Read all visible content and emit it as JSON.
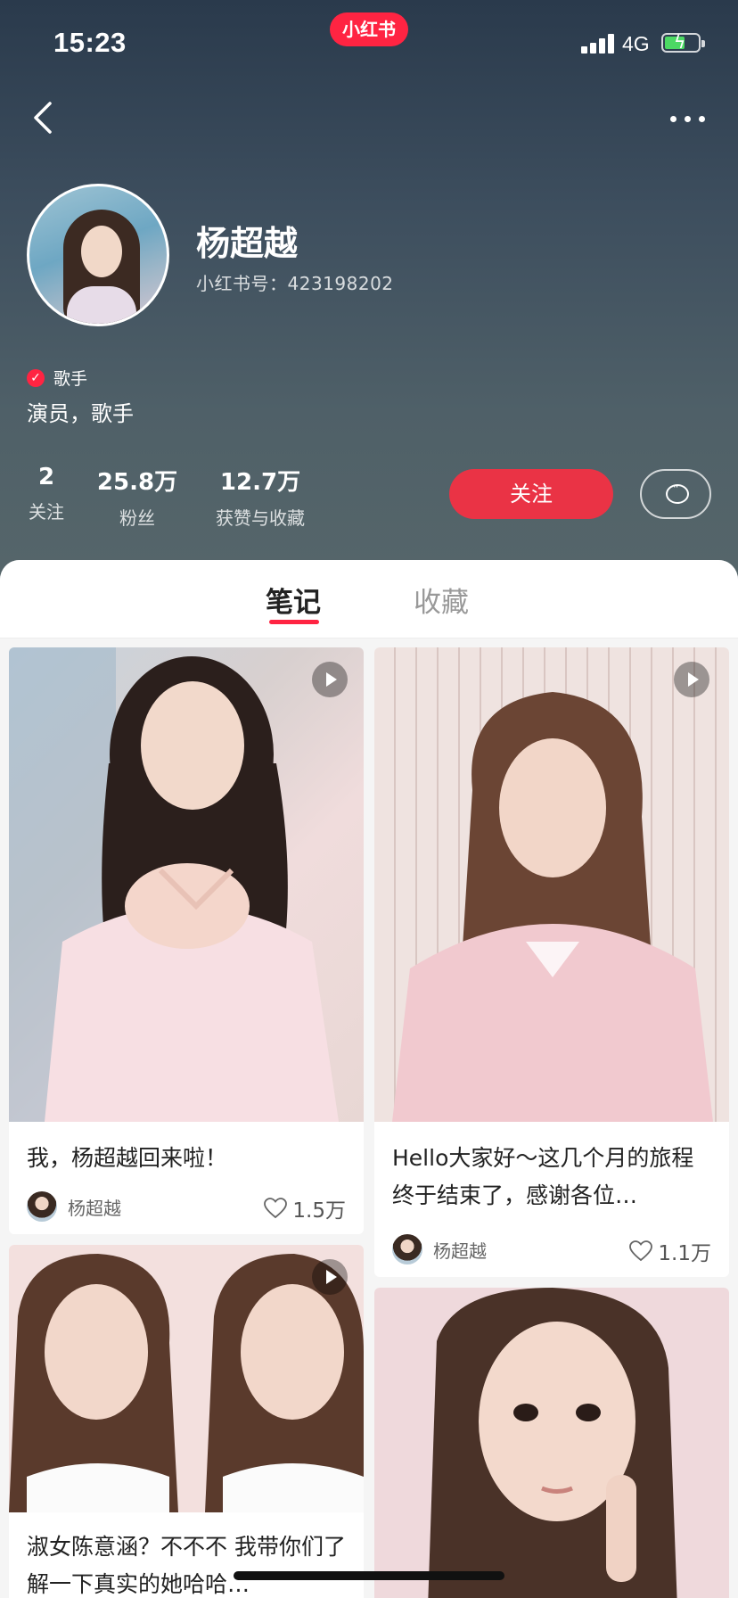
{
  "status_bar": {
    "time": "15:23",
    "app_badge": "小红书",
    "network": "4G"
  },
  "profile": {
    "name": "杨超越",
    "account_id": "小红书号：423198202",
    "verified_label": "歌手",
    "bio": "演员，歌手",
    "stats": [
      {
        "value": "2",
        "label": "关注"
      },
      {
        "value": "25.8万",
        "label": "粉丝"
      },
      {
        "value": "12.7万",
        "label": "获赞与收藏"
      }
    ],
    "follow_label": "关注"
  },
  "tabs": [
    {
      "label": "笔记",
      "active": true
    },
    {
      "label": "收藏",
      "active": false
    }
  ],
  "notes": [
    {
      "title": "我，杨超越回来啦！",
      "author": "杨超越",
      "likes": "1.5万",
      "is_video": true
    },
    {
      "title": "Hello大家好～这几个月的旅程终于结束了，感谢各位…",
      "author": "杨超越",
      "likes": "1.1万",
      "is_video": true
    },
    {
      "title": "淑女陈意涵？不不不 我带你们了解一下真实的她哈哈…",
      "author": "",
      "likes": "",
      "is_video": true
    },
    {
      "title": "",
      "author": "",
      "likes": "",
      "is_video": false
    }
  ],
  "colors": {
    "accent": "#ff2442",
    "follow_button": "#ea3345",
    "header_top": "#2a3a4c",
    "header_bottom": "#56666a"
  },
  "icons": [
    "back-icon",
    "more-icon",
    "verified-icon",
    "message-icon",
    "play-icon",
    "heart-icon"
  ]
}
